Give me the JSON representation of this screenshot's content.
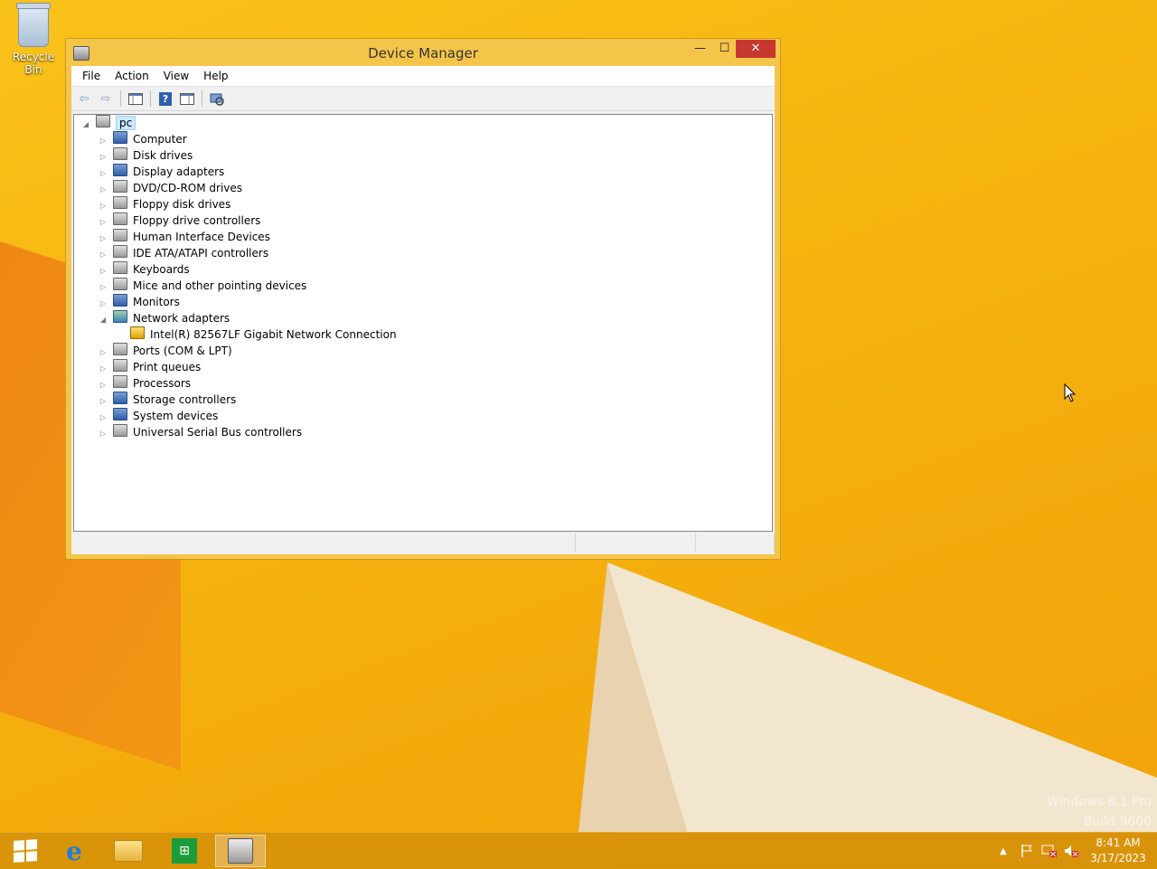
{
  "desktop": {
    "recycle_bin_label": "Recycle Bin",
    "watermark_line1": "Windows 8.1 Pro",
    "watermark_line2": "Build 9600"
  },
  "window": {
    "title": "Device Manager",
    "minimize_glyph": "—",
    "maximize_glyph": "☐",
    "close_glyph": "✕"
  },
  "menu": [
    "File",
    "Action",
    "View",
    "Help"
  ],
  "toolbar": {
    "back_glyph": "⇦",
    "forward_glyph": "⇨",
    "help_glyph": "?"
  },
  "tree": {
    "root": "pc",
    "items": [
      {
        "label": "Computer",
        "expanded": false
      },
      {
        "label": "Disk drives",
        "expanded": false
      },
      {
        "label": "Display adapters",
        "expanded": false
      },
      {
        "label": "DVD/CD-ROM drives",
        "expanded": false
      },
      {
        "label": "Floppy disk drives",
        "expanded": false
      },
      {
        "label": "Floppy drive controllers",
        "expanded": false
      },
      {
        "label": "Human Interface Devices",
        "expanded": false
      },
      {
        "label": "IDE ATA/ATAPI controllers",
        "expanded": false
      },
      {
        "label": "Keyboards",
        "expanded": false
      },
      {
        "label": "Mice and other pointing devices",
        "expanded": false
      },
      {
        "label": "Monitors",
        "expanded": false
      },
      {
        "label": "Network adapters",
        "expanded": true
      },
      {
        "label": "Intel(R) 82567LF Gigabit Network Connection",
        "child": true
      },
      {
        "label": "Ports (COM & LPT)",
        "expanded": false
      },
      {
        "label": "Print queues",
        "expanded": false
      },
      {
        "label": "Processors",
        "expanded": false
      },
      {
        "label": "Storage controllers",
        "expanded": false
      },
      {
        "label": "System devices",
        "expanded": false
      },
      {
        "label": "Universal Serial Bus controllers",
        "expanded": false
      }
    ]
  },
  "taskbar": {
    "clock_time": "8:41 AM",
    "clock_date": "3/17/2023"
  }
}
